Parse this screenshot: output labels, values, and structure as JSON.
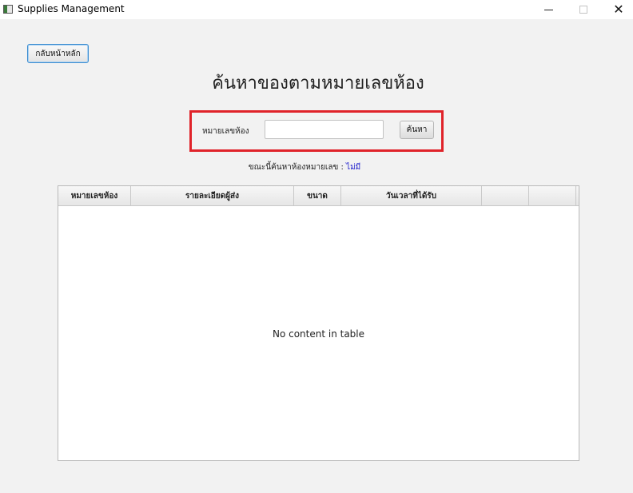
{
  "window": {
    "title": "Supplies Management",
    "minimize_symbol": "",
    "maximize_symbol": "",
    "close_symbol": "✕"
  },
  "back_button_label": "กลับหน้าหลัก",
  "page_title": "ค้นหาของตามหมายเลขห้อง",
  "search": {
    "label": "หมายเลขห้อง",
    "input_value": "",
    "button_label": "ค้นหา",
    "highlight_color": "#e0232a"
  },
  "status": {
    "prefix": "ขณะนี้ค้นหาห้องหมายเลข :",
    "value": "ไม่มี",
    "value_color": "#1d1dcc"
  },
  "table": {
    "columns": [
      "หมายเลขห้อง",
      "รายละเอียดผู้ส่ง",
      "ขนาด",
      "วันเวลาที่ได้รับ",
      "",
      ""
    ],
    "empty_message": "No content in table"
  }
}
